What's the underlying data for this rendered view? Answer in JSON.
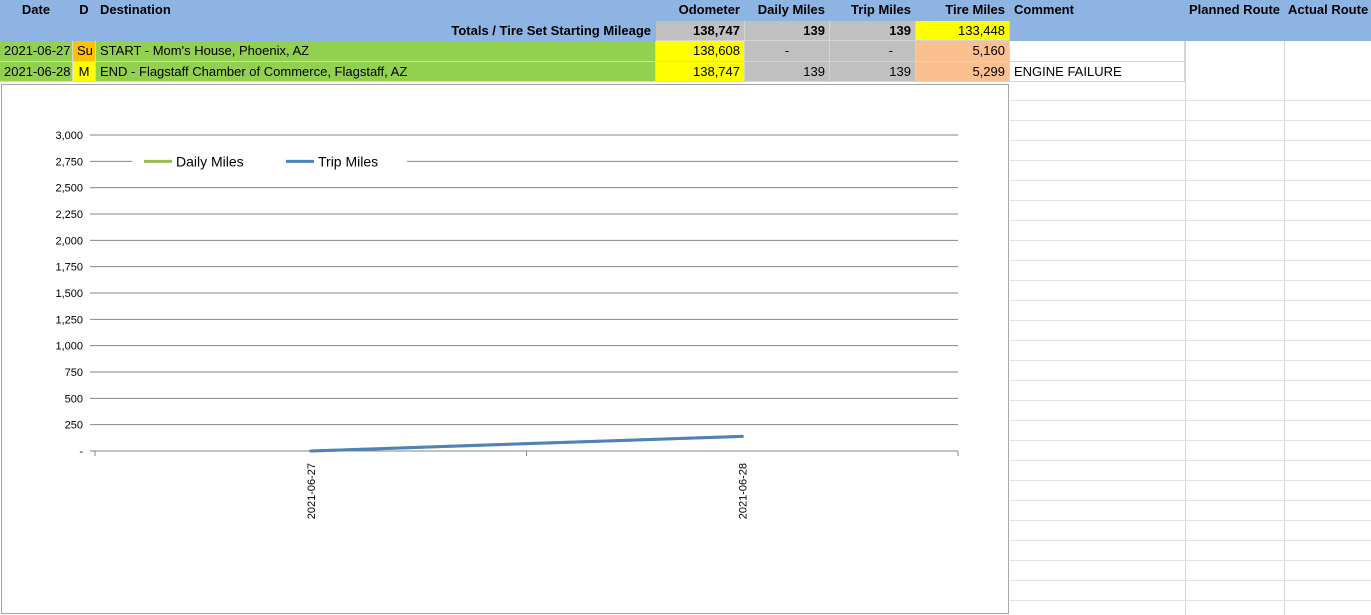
{
  "header": {
    "date": "Date",
    "day": "D",
    "destination": "Destination",
    "odometer": "Odometer",
    "daily_miles": "Daily Miles",
    "trip_miles": "Trip Miles",
    "tire_miles": "Tire Miles",
    "comment": "Comment",
    "planned_route": "Planned Route",
    "actual_route": "Actual Route"
  },
  "totals": {
    "label": "Totals / Tire Set Starting Mileage",
    "odometer": "138,747",
    "daily_miles": "139",
    "trip_miles": "139",
    "tire_miles": "133,448"
  },
  "rows": [
    {
      "date": "2021-06-27",
      "day": "Su",
      "destination": "START - Mom's House, Phoenix, AZ",
      "odometer": "138,608",
      "daily_miles": "-",
      "trip_miles": "-",
      "tire_miles": "5,160",
      "comment": ""
    },
    {
      "date": "2021-06-28",
      "day": "M",
      "destination": "END - Flagstaff Chamber of Commerce, Flagstaff, AZ",
      "odometer": "138,747",
      "daily_miles": "139",
      "trip_miles": "139",
      "tire_miles": "5,299",
      "comment": "ENGINE FAILURE"
    }
  ],
  "colors": {
    "header_bg": "#8db4e2",
    "totals_gray": "#c0c0c0",
    "highlight_yellow": "#ffff00",
    "start_green": "#92d050",
    "tire_orange": "#fac090",
    "day_amber": "#ffc000",
    "daily_series": "#9bbb59",
    "trip_series": "#4f81bd"
  },
  "chart_data": {
    "type": "line",
    "categories": [
      "2021-06-27",
      "2021-06-28"
    ],
    "series": [
      {
        "name": "Daily Miles",
        "values": [
          0,
          139
        ],
        "color": "#9bbb59"
      },
      {
        "name": "Trip Miles",
        "values": [
          0,
          139
        ],
        "color": "#4f81bd"
      }
    ],
    "ylim": [
      0,
      3000
    ],
    "yticks": [
      "-",
      "250",
      "500",
      "750",
      "1,000",
      "1,250",
      "1,500",
      "1,750",
      "2,000",
      "2,250",
      "2,500",
      "2,750",
      "3,000"
    ],
    "ytick_values": [
      0,
      250,
      500,
      750,
      1000,
      1250,
      1500,
      1750,
      2000,
      2250,
      2500,
      2750,
      3000
    ],
    "grid": true,
    "legend": "top-left",
    "title": "",
    "xlabel": "",
    "ylabel": ""
  }
}
